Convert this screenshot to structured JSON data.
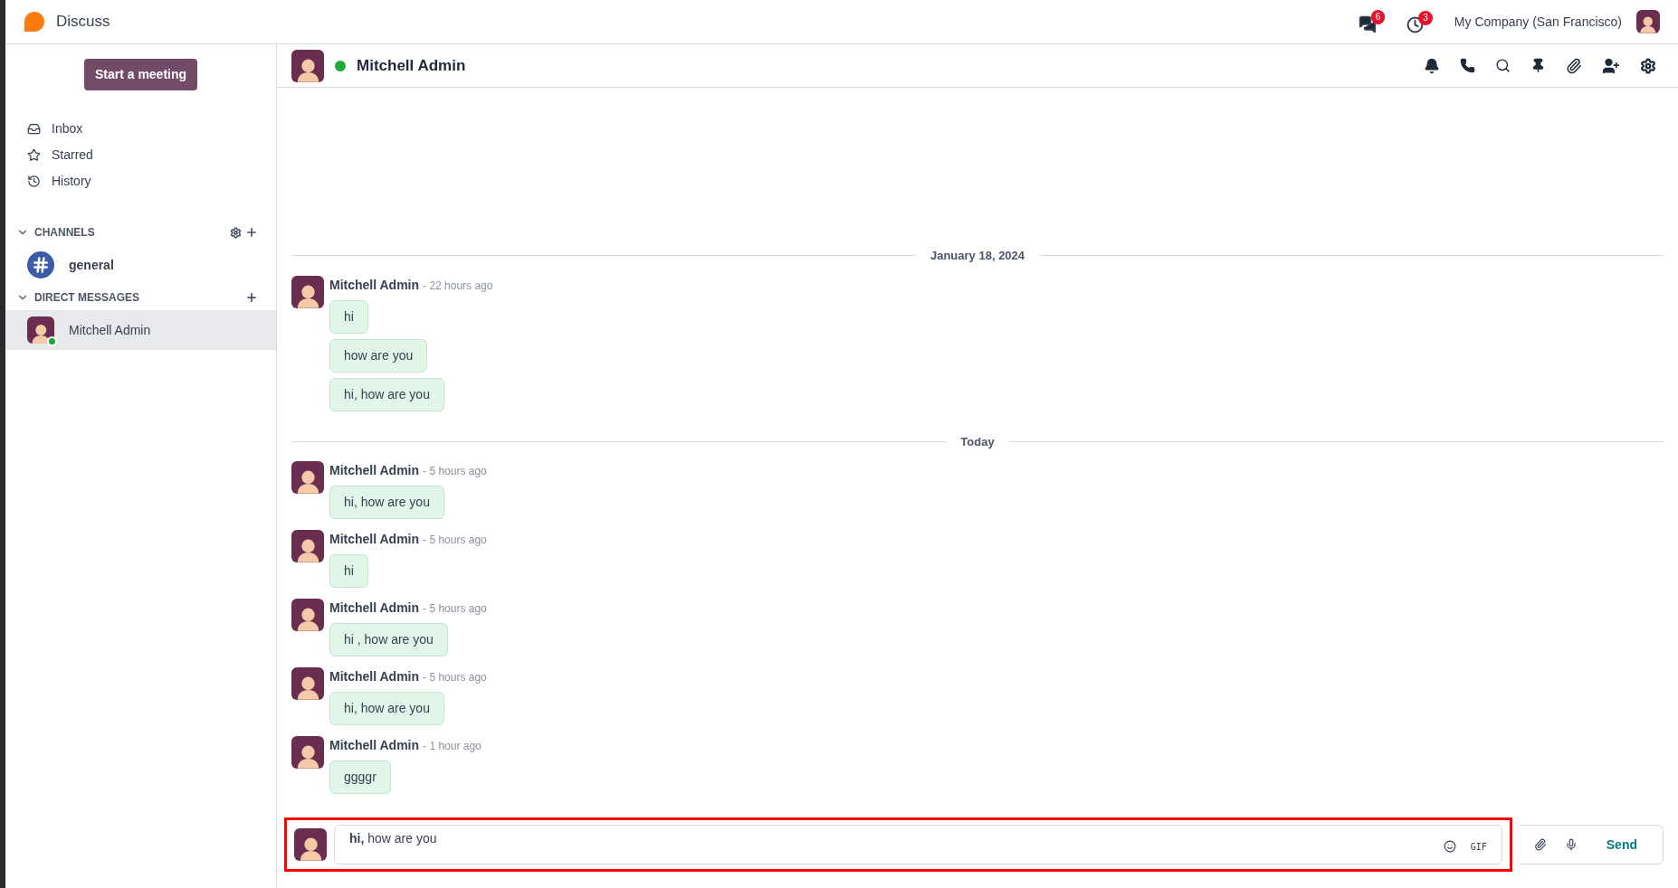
{
  "app": {
    "title": "Discuss"
  },
  "topbar": {
    "messages_badge": "6",
    "activities_badge": "3",
    "company": "My Company (San Francisco)"
  },
  "sidebar": {
    "meeting_button": "Start a meeting",
    "nav": [
      {
        "kind": "inbox",
        "label": "Inbox"
      },
      {
        "kind": "starred",
        "label": "Starred"
      },
      {
        "kind": "history",
        "label": "History"
      }
    ],
    "sections": [
      {
        "title": "CHANNELS",
        "expanded": true,
        "actions": [
          {
            "kind": "settings"
          },
          {
            "kind": "add"
          }
        ],
        "items": [
          {
            "kind": "channel",
            "label": "general",
            "selected": false
          }
        ]
      },
      {
        "title": "DIRECT MESSAGES",
        "expanded": true,
        "actions": [
          {
            "kind": "add"
          }
        ],
        "items": [
          {
            "kind": "person",
            "label": "Mitchell Admin",
            "selected": true,
            "online": true
          }
        ]
      }
    ]
  },
  "chat": {
    "name": "Mitchell Admin",
    "online": true,
    "groups": [
      {
        "date": "January 18, 2024",
        "messages": [
          {
            "author": "Mitchell Admin",
            "time": "- 22 hours ago",
            "bubbles": [
              "hi",
              "how are you",
              "hi, how are you"
            ]
          }
        ]
      },
      {
        "date": "Today",
        "messages": [
          {
            "author": "Mitchell Admin",
            "time": "- 5 hours ago",
            "bubbles": [
              "hi, how are you"
            ]
          },
          {
            "author": "Mitchell Admin",
            "time": "- 5 hours ago",
            "bubbles": [
              "hi"
            ]
          },
          {
            "author": "Mitchell Admin",
            "time": "- 5 hours ago",
            "bubbles": [
              "hi , how are you"
            ]
          },
          {
            "author": "Mitchell Admin",
            "time": "- 5 hours ago",
            "bubbles": [
              "hi, how are you"
            ]
          },
          {
            "author": "Mitchell Admin",
            "time": "- 1 hour ago",
            "bubbles": [
              "ggggr"
            ]
          }
        ]
      }
    ]
  },
  "composer": {
    "value": "**hi,** how are you",
    "gif": "GIF",
    "send": "Send",
    "highlighted": true
  }
}
